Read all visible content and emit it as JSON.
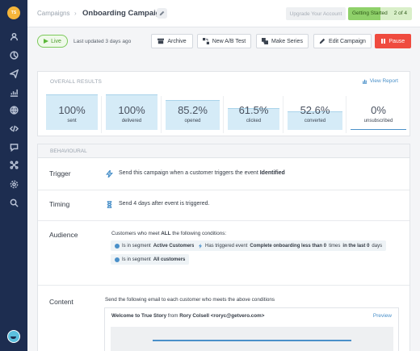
{
  "sidebar": {
    "logo_text": "TS",
    "items": [
      {
        "icon": "user-icon"
      },
      {
        "icon": "segments-icon"
      },
      {
        "icon": "campaigns-icon"
      },
      {
        "icon": "analytics-icon"
      },
      {
        "icon": "globe-icon"
      },
      {
        "icon": "code-icon"
      },
      {
        "icon": "chat-icon"
      },
      {
        "icon": "integrations-icon"
      },
      {
        "icon": "settings-icon"
      },
      {
        "icon": "search-icon"
      }
    ],
    "avatar": "user-avatar"
  },
  "header": {
    "breadcrumb": "Campaigns",
    "separator": "›",
    "title": "Onboarding Campaign",
    "upgrade_label": "Upgrade Your Account",
    "getting_started_label": "Getting Started",
    "getting_started_count": "2 of 4",
    "getting_started_progress": 0.5
  },
  "actions": {
    "live_label": "Live",
    "last_updated": "Last updated 3 days ago",
    "archive_label": "Archive",
    "ab_test_label": "New A/B Test",
    "make_series_label": "Make Series",
    "edit_label": "Edit Campaign",
    "pause_label": "Pause"
  },
  "overall": {
    "section_label": "OVERALL RESULTS",
    "view_report_label": "View Report",
    "metrics": [
      {
        "value": "100%",
        "label": "sent",
        "fill": 1.0
      },
      {
        "value": "100%",
        "label": "delivered",
        "fill": 1.0
      },
      {
        "value": "85.2%",
        "label": "opened",
        "fill": 0.852
      },
      {
        "value": "61.5%",
        "label": "clicked",
        "fill": 0.615
      },
      {
        "value": "52.6%",
        "label": "converted",
        "fill": 0.526
      },
      {
        "value": "0%",
        "label": "unsubscribed",
        "fill": 0.0
      }
    ]
  },
  "behavioural": {
    "section_label": "BEHAVIOURAL",
    "trigger": {
      "title": "Trigger",
      "text": "Send this campaign when a customer triggers the event",
      "event": "Identified"
    },
    "timing": {
      "title": "Timing",
      "text": "Send 4 days after event is triggered."
    },
    "audience": {
      "title": "Audience",
      "intro_prefix": "Customers who meet",
      "intro_bold": "ALL",
      "intro_suffix": "the following conditions:",
      "condition_1_prefix": "Is in segment",
      "condition_1_value": "Active Customers",
      "condition_2_prefix": "Has triggered event",
      "condition_2_event": "Complete onboarding less than 0",
      "condition_2_mid": "times",
      "condition_2_range": "in the last 0",
      "condition_2_suffix": "days",
      "condition_3_prefix": "Is in segment",
      "condition_3_value": "All customers"
    },
    "content": {
      "title": "Content",
      "text": "Send the following email to each customer who meets the above conditions",
      "email_subject": "Welcome to True Story",
      "email_from_label": "from",
      "email_from": "Rory Colsell <roryc@getvero.com>",
      "preview_label": "Preview"
    }
  }
}
